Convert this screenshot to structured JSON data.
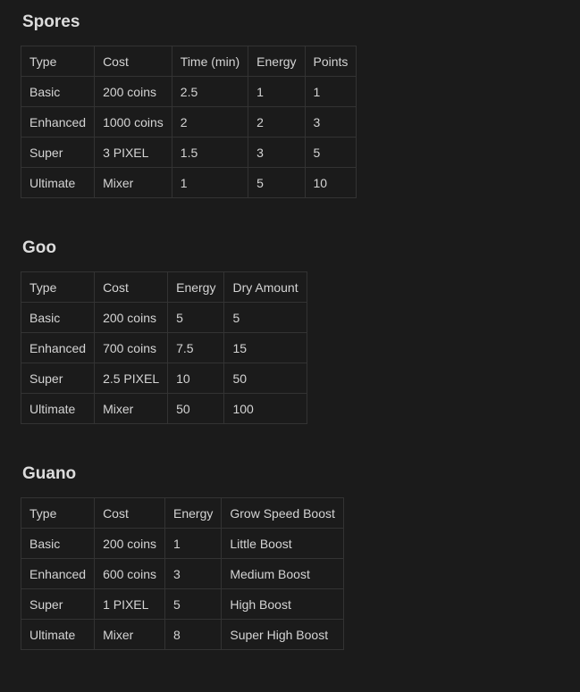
{
  "sections": [
    {
      "title": "Spores",
      "headers": [
        "Type",
        "Cost",
        "Time (min)",
        "Energy",
        "Points"
      ],
      "rows": [
        [
          "Basic",
          "200 coins",
          "2.5",
          "1",
          "1"
        ],
        [
          "Enhanced",
          "1000 coins",
          "2",
          "2",
          "3"
        ],
        [
          "Super",
          "3 PIXEL",
          "1.5",
          "3",
          "5"
        ],
        [
          "Ultimate",
          "Mixer",
          "1",
          "5",
          "10"
        ]
      ]
    },
    {
      "title": "Goo",
      "headers": [
        "Type",
        "Cost",
        "Energy",
        "Dry Amount"
      ],
      "rows": [
        [
          "Basic",
          "200 coins",
          "5",
          "5"
        ],
        [
          "Enhanced",
          "700 coins",
          "7.5",
          "15"
        ],
        [
          "Super",
          "2.5 PIXEL",
          "10",
          "50"
        ],
        [
          "Ultimate",
          "Mixer",
          "50",
          "100"
        ]
      ]
    },
    {
      "title": "Guano",
      "headers": [
        "Type",
        "Cost",
        "Energy",
        "Grow Speed Boost"
      ],
      "rows": [
        [
          "Basic",
          "200 coins",
          "1",
          "Little Boost"
        ],
        [
          "Enhanced",
          "600 coins",
          "3",
          "Medium Boost"
        ],
        [
          "Super",
          "1 PIXEL",
          "5",
          "High Boost"
        ],
        [
          "Ultimate",
          "Mixer",
          "8",
          "Super High Boost"
        ]
      ]
    }
  ]
}
